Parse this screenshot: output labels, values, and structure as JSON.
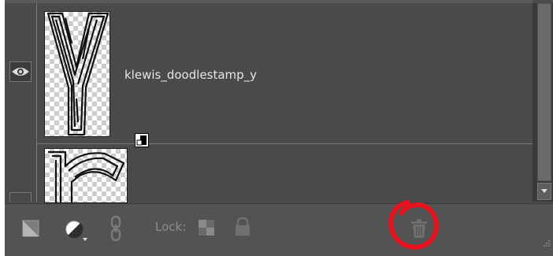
{
  "layers_panel": {
    "layers": [
      {
        "name": "klewis_doodlestamp_y",
        "visible": true,
        "thumbnail_icon": "letter-y-thumbnail",
        "smart_object_badge": true
      },
      {
        "name": "",
        "visible": false,
        "thumbnail_icon": "letter-r-thumbnail",
        "smart_object_badge": false
      }
    ]
  },
  "toolbar": {
    "new_layer_icon": "new-layer-icon",
    "adjustment_icon": "adjustment-layer-icon",
    "link_icon": "link-icon",
    "lock_label": "Lock:",
    "lock_transparent_icon": "lock-transparent-pixels-icon",
    "lock_all_icon": "lock-icon",
    "delete_icon": "trash-icon"
  },
  "annotation": {
    "shape": "hand-drawn-circle",
    "color": "#e8131f",
    "target": "delete-layer-button"
  },
  "colors": {
    "panel_bg": "#4a4a4a",
    "toolbar_bg": "#535353",
    "text": "#e6e6e6",
    "annotation": "#e8131f"
  }
}
